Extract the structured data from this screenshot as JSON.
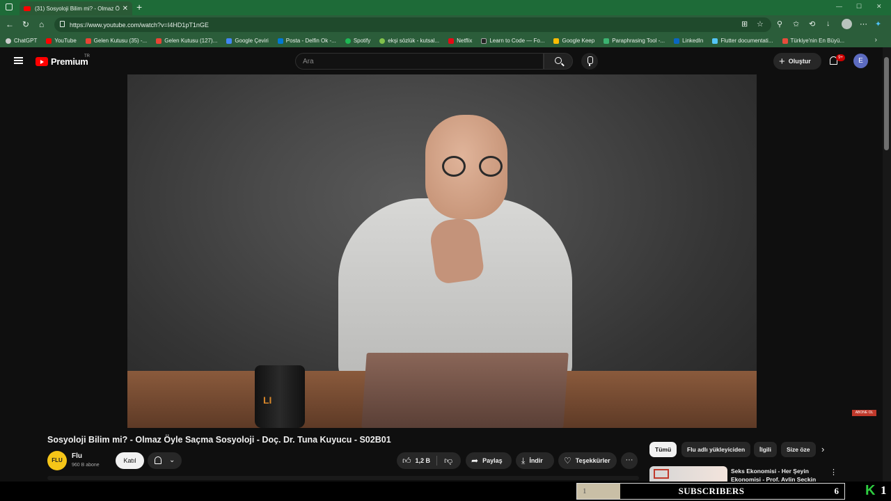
{
  "browser": {
    "tab_title": "(31) Sosyoloji Bilim mi? - Olmaz Ö",
    "url": "https://www.youtube.com/watch?v=I4HD1pT1nGE",
    "bookmarks": [
      {
        "label": "ChatGPT",
        "color": "#cccccc"
      },
      {
        "label": "YouTube",
        "color": "#ff0000"
      },
      {
        "label": "Gelen Kutusu (35) -...",
        "color": "#ea4335"
      },
      {
        "label": "Gelen Kutusu (127)...",
        "color": "#ea4335"
      },
      {
        "label": "Google Çeviri",
        "color": "#4285f4"
      },
      {
        "label": "Posta - Delfin Ok -...",
        "color": "#0078d4"
      },
      {
        "label": "Spotify",
        "color": "#1db954"
      },
      {
        "label": "ekşi sözlük - kutsal...",
        "color": "#81c14b"
      },
      {
        "label": "Netflix",
        "color": "#e50914"
      },
      {
        "label": "Learn to Code — Fo...",
        "color": "#222222"
      },
      {
        "label": "Google Keep",
        "color": "#fbbc04"
      },
      {
        "label": "Paraphrasing Tool -...",
        "color": "#3cb371"
      },
      {
        "label": "LinkedIn",
        "color": "#0a66c2"
      },
      {
        "label": "Flutter documentati...",
        "color": "#54c5f8"
      },
      {
        "label": "Türkiye'nin En Büyü...",
        "color": "#e74c3c"
      }
    ]
  },
  "youtube": {
    "logo_text": "Premium",
    "region": "TR",
    "search_placeholder": "Ara",
    "create_label": "Oluştur",
    "notifications_badge": "9+",
    "user_initial": "E"
  },
  "video": {
    "title": "Sosyoloji Bilim mi? - Olmaz Öyle Saçma Sosyoloji - Doç. Dr. Tuna Kuyucu - S02B01",
    "overlay_badge": "ABONE OL",
    "mug_logo": "LI"
  },
  "channel": {
    "avatar_text": "FLU",
    "name": "Flu",
    "subscribers": "960 B abone",
    "join_label": "Katıl"
  },
  "actions": {
    "likes": "1,2 B",
    "share": "Paylaş",
    "download": "İndir",
    "thanks": "Teşekkürler"
  },
  "chips": [
    "Tümü",
    "Flu adlı yükleyiciden",
    "İlgili",
    "Size öze"
  ],
  "recommendation": {
    "title": "Seks Ekonomisi - Her Şeyin Ekonomisi - Prof. Aylin Seçkin"
  },
  "overlay_bar": {
    "rank": "1",
    "label": "SUBSCRIBERS",
    "count": "6",
    "right_number": "1",
    "logo": "K"
  }
}
